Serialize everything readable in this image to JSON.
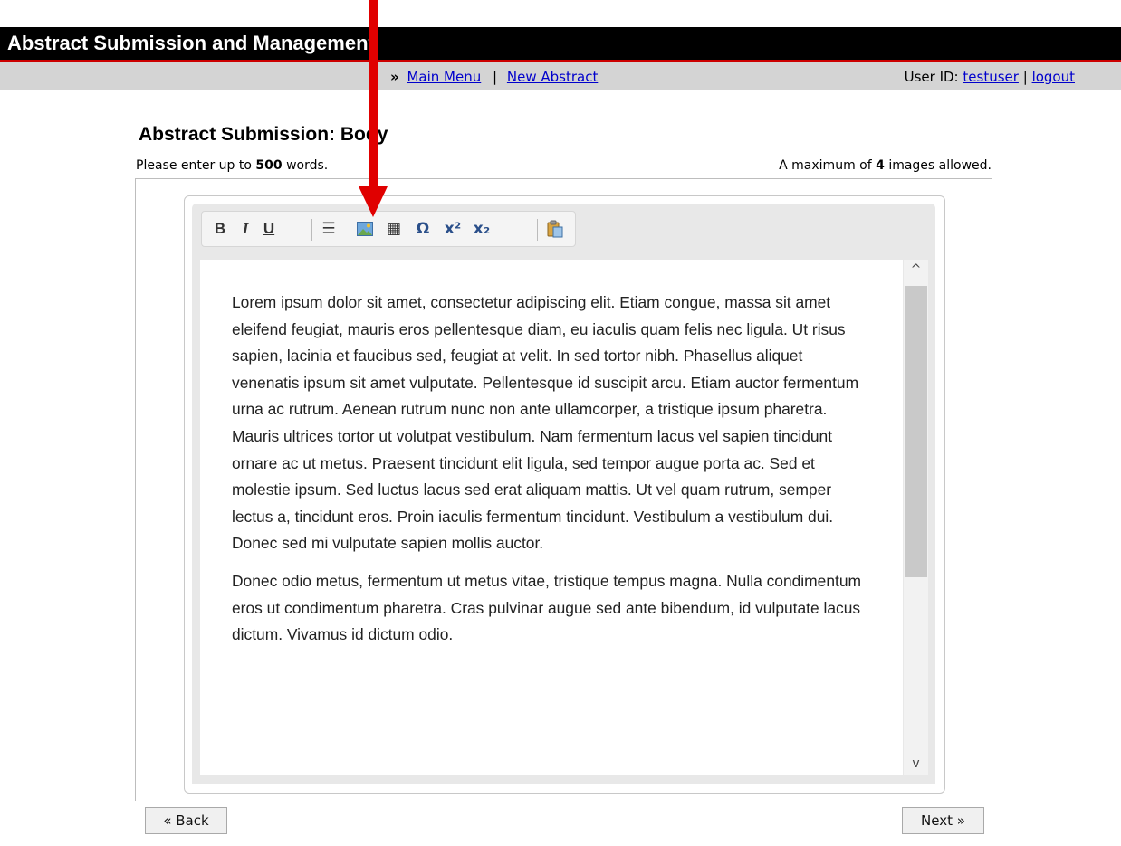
{
  "header": {
    "app_title": "Abstract Submission and Management"
  },
  "nav": {
    "raquo": "»",
    "main_menu": "Main Menu",
    "separator": "|",
    "new_abstract": "New Abstract",
    "user_id_label": "User ID:",
    "user_id": "testuser",
    "logout": "logout"
  },
  "page": {
    "title": "Abstract Submission: Body",
    "word_limit_prefix": "Please enter up to",
    "word_limit_value": "500",
    "word_limit_suffix": "words.",
    "image_limit_prefix": "A maximum of",
    "image_limit_value": "4",
    "image_limit_suffix": "images allowed."
  },
  "toolbar": {
    "bold": "B",
    "italic": "I",
    "underline": "U",
    "list": "☰",
    "table": "▦",
    "omega": "Ω",
    "superscript": "x²",
    "subscript": "x₂",
    "icons": [
      "bold-icon",
      "italic-icon",
      "underline-icon",
      "bullet-list-icon",
      "insert-image-icon",
      "insert-table-icon",
      "special-character-icon",
      "superscript-icon",
      "subscript-icon",
      "paste-icon"
    ]
  },
  "editor": {
    "paragraphs": [
      "Lorem ipsum dolor sit amet, consectetur adipiscing elit. Etiam congue, massa sit amet eleifend feugiat, mauris eros pellentesque diam, eu iaculis quam felis nec ligula. Ut risus sapien, lacinia et faucibus sed, feugiat at velit. In sed tortor nibh. Phasellus aliquet venenatis ipsum sit amet vulputate. Pellentesque id suscipit arcu. Etiam auctor fermentum urna ac rutrum. Aenean rutrum nunc non ante ullamcorper, a tristique ipsum pharetra. Mauris ultrices tortor ut volutpat vestibulum. Nam fermentum lacus vel sapien tincidunt ornare ac ut metus. Praesent tincidunt elit ligula, sed tempor augue porta ac. Sed et molestie ipsum. Sed luctus lacus sed erat aliquam mattis. Ut vel quam rutrum, semper lectus a, tincidunt eros. Proin iaculis fermentum tincidunt. Vestibulum a vestibulum dui. Donec sed mi vulputate sapien mollis auctor.",
      "Donec odio metus, fermentum ut metus vitae, tristique tempus magna. Nulla condimentum eros ut condimentum pharetra. Cras pulvinar augue sed ante bibendum, id vulputate lacus dictum. Vivamus id dictum odio."
    ]
  },
  "scrollbar": {
    "up": "^",
    "down": "v"
  },
  "buttons": {
    "back": "« Back",
    "next": "Next »"
  },
  "colors": {
    "header_bg": "#000000",
    "accent_line": "#cc0000",
    "nav_bg": "#d4d4d4",
    "link": "#0000cc",
    "annotation_arrow": "#e00000"
  }
}
